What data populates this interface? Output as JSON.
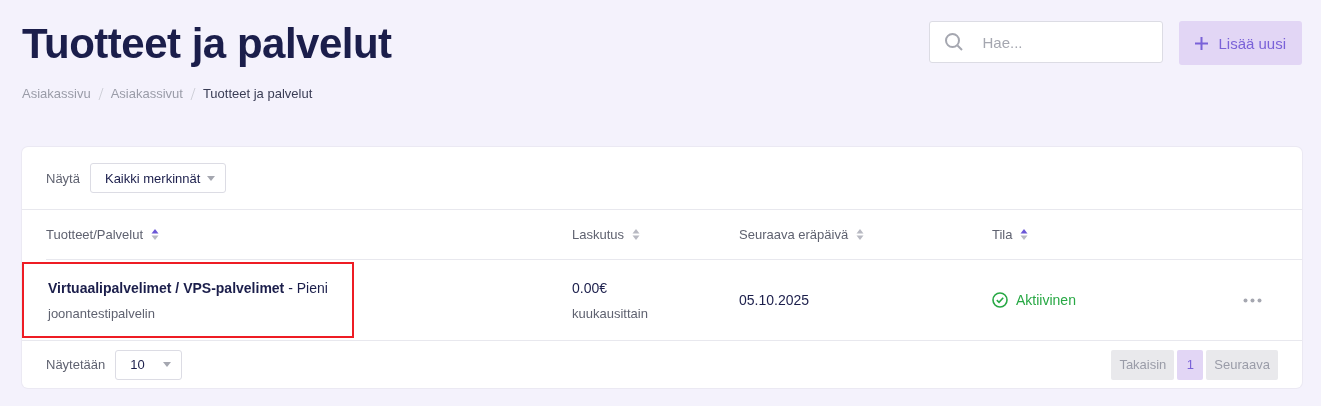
{
  "page": {
    "title": "Tuotteet ja palvelut"
  },
  "breadcrumbs": [
    {
      "label": "Asiakassivu",
      "current": false
    },
    {
      "label": "Asiakassivut",
      "current": false
    },
    {
      "label": "Tuotteet ja palvelut",
      "current": true
    }
  ],
  "search": {
    "placeholder": "Hae..."
  },
  "add_button": {
    "label": "Lisää uusi"
  },
  "filter": {
    "label": "Näytä",
    "value": "Kaikki merkinnät"
  },
  "table": {
    "columns": [
      {
        "label": "Tuotteet/Palvelut",
        "sorted": true
      },
      {
        "label": "Laskutus",
        "sorted": false
      },
      {
        "label": "Seuraava eräpäivä",
        "sorted": false
      },
      {
        "label": "Tila",
        "sorted": true
      }
    ],
    "rows": [
      {
        "product": "**Virtuaalipalvelimet / VPS-palvelimet** - Pieni",
        "name": "joonantestipalvelin",
        "amount": "0.00€",
        "cycle": "kuukausittain",
        "due": "05.10.2025",
        "status": "Aktiivinen",
        "active": true,
        "highlighted": true
      }
    ]
  },
  "page_size": {
    "label": "Näytetään",
    "value": "10"
  },
  "pagination": {
    "prev": {
      "label": "Takaisin",
      "disabled": true
    },
    "pages": [
      {
        "label": "1",
        "selected": true
      }
    ],
    "next": {
      "label": "Seuraava",
      "disabled": true
    }
  }
}
